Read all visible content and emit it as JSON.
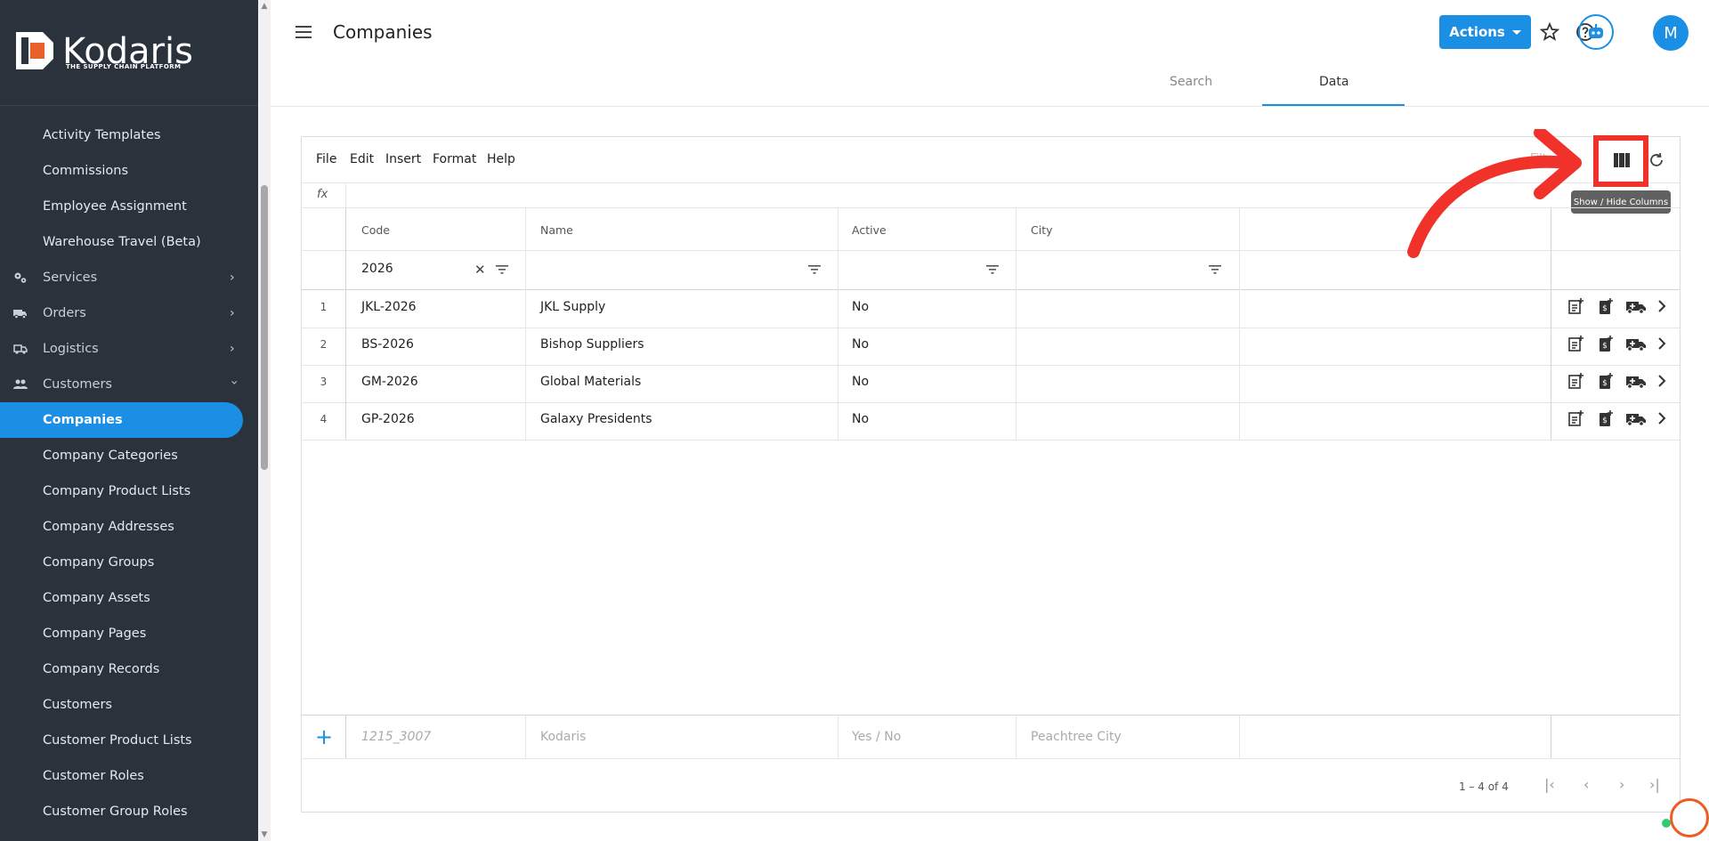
{
  "brand": {
    "name": "Kodaris",
    "tagline": "THE SUPPLY CHAIN PLATFORM"
  },
  "sidebar": {
    "items": [
      {
        "label": "Activity Templates"
      },
      {
        "label": "Commissions"
      },
      {
        "label": "Employee Assignment"
      },
      {
        "label": "Warehouse Travel (Beta)"
      },
      {
        "label": "Services",
        "icon": "gears-icon"
      },
      {
        "label": "Orders",
        "icon": "truck-icon"
      },
      {
        "label": "Logistics",
        "icon": "delivery-icon"
      },
      {
        "label": "Customers",
        "icon": "people-icon"
      },
      {
        "label": "Companies"
      },
      {
        "label": "Company Categories"
      },
      {
        "label": "Company Product Lists"
      },
      {
        "label": "Company Addresses"
      },
      {
        "label": "Company Groups"
      },
      {
        "label": "Company Assets"
      },
      {
        "label": "Company Pages"
      },
      {
        "label": "Company Records"
      },
      {
        "label": "Customers"
      },
      {
        "label": "Customer Product Lists"
      },
      {
        "label": "Customer Roles"
      },
      {
        "label": "Customer Group Roles"
      }
    ]
  },
  "header": {
    "title": "Companies",
    "actions_label": "Actions",
    "avatar_letter": "M",
    "tabs": [
      {
        "label": "Search"
      },
      {
        "label": "Data"
      }
    ]
  },
  "grid": {
    "menu": [
      "File",
      "Edit",
      "Insert",
      "Format",
      "Help"
    ],
    "filter_label": "Filter",
    "tooltip": "Show / Hide Columns",
    "fx": "fx",
    "columns": [
      "Code",
      "Name",
      "Active",
      "City"
    ],
    "code_filter": "2026",
    "rows": [
      {
        "num": "1",
        "code": "JKL-2026",
        "name": "JKL Supply",
        "active": "No"
      },
      {
        "num": "2",
        "code": "BS-2026",
        "name": "Bishop Suppliers",
        "active": "No"
      },
      {
        "num": "3",
        "code": "GM-2026",
        "name": "Global Materials",
        "active": "No"
      },
      {
        "num": "4",
        "code": "GP-2026",
        "name": "Galaxy Presidents",
        "active": "No"
      }
    ],
    "new_row_placeholders": {
      "code": "1215_3007",
      "name": "Kodaris",
      "active": "Yes / No",
      "city": "Peachtree City"
    },
    "pager": "1 – 4 of 4"
  },
  "colors": {
    "accent": "#1a8fe3",
    "sidebar": "#2a323c",
    "highlight": "#f0322a"
  }
}
